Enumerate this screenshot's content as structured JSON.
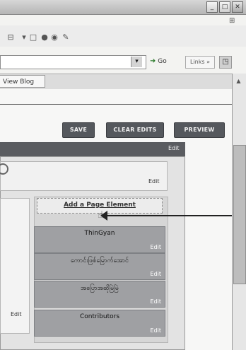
{
  "window": {
    "minimize": "_",
    "maximize": "□",
    "close": "✕",
    "logo": "⊞"
  },
  "toolbar": {
    "icons": [
      "⊟",
      "▾",
      "□",
      "●",
      "◉",
      "✎"
    ]
  },
  "address": {
    "go_label": "Go",
    "links_label": "Links »",
    "ext_icon": "◳"
  },
  "tab": {
    "label": "View Blog"
  },
  "buttons": {
    "save": "SAVE",
    "clear_edits": "CLEAR EDITS",
    "preview": "PREVIEW"
  },
  "layout": {
    "header_edit": "Edit",
    "header_box_edit": "Edit",
    "main_edit": "Edit",
    "add_page_element": "Add a Page Element"
  },
  "widgets": [
    {
      "title": "ThinGyan",
      "edit": "Edit"
    },
    {
      "title": "ကောင်းဖြစ်မြောက်အောင်",
      "edit": "Edit"
    },
    {
      "title": "အပြောအဆိုမြဲမြဲ",
      "edit": "Edit"
    },
    {
      "title": "Contributors",
      "edit": "Edit"
    }
  ],
  "scrollbar": {
    "up_arrow": "▲"
  }
}
